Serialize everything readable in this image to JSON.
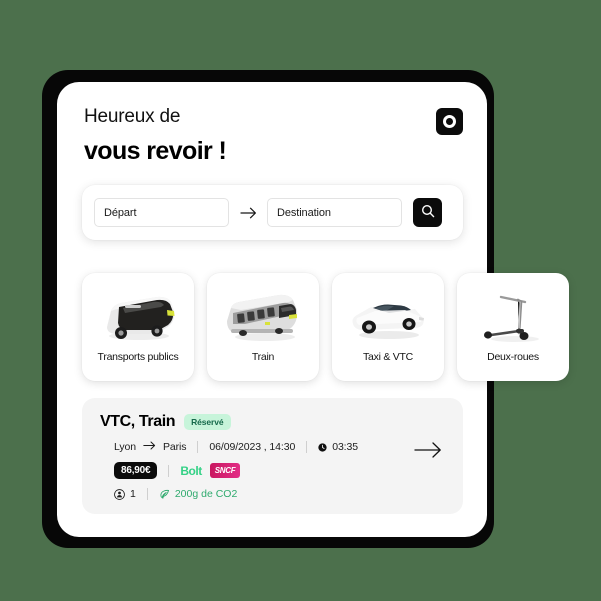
{
  "theme": {
    "background": "#4c704c",
    "card_background": "#ffffff",
    "accent_black": "#0b0b0b",
    "badge_mint_bg": "#c7f4da",
    "badge_mint_text": "#15694a",
    "bolt_green": "#34d186",
    "sncf_magenta": "#d3236e",
    "co2_green": "#2faa6e"
  },
  "header": {
    "line1": "Heureux de",
    "line2": "vous revoir !",
    "logo_icon": "ring-logo-icon"
  },
  "search": {
    "origin_placeholder": "Départ",
    "origin_value": "",
    "destination_placeholder": "Destination",
    "destination_value": "",
    "separator_icon": "arrow-right-icon",
    "submit_icon": "search-icon"
  },
  "categories": [
    {
      "label": "Transports publics",
      "icon": "bus-icon"
    },
    {
      "label": "Train",
      "icon": "tram-icon"
    },
    {
      "label": "Taxi & VTC",
      "icon": "car-icon"
    },
    {
      "label": "Deux-roues",
      "icon": "scooter-icon"
    }
  ],
  "booking": {
    "title": "VTC, Train",
    "status_badge": "Réservé",
    "origin": "Lyon",
    "route_icon": "arrow-right-icon",
    "destination": "Paris",
    "datetime": "06/09/2023 , 14:30",
    "duration_icon": "clock-icon",
    "duration": "03:35",
    "price": "86,90€",
    "operators": [
      {
        "name": "Bolt",
        "style": "text"
      },
      {
        "name": "SNCF",
        "style": "badge"
      }
    ],
    "passenger_icon": "passenger-icon",
    "passengers": "1",
    "co2_icon": "leaf-icon",
    "co2": "200g de CO2",
    "detail_icon": "arrow-right-long-icon"
  }
}
